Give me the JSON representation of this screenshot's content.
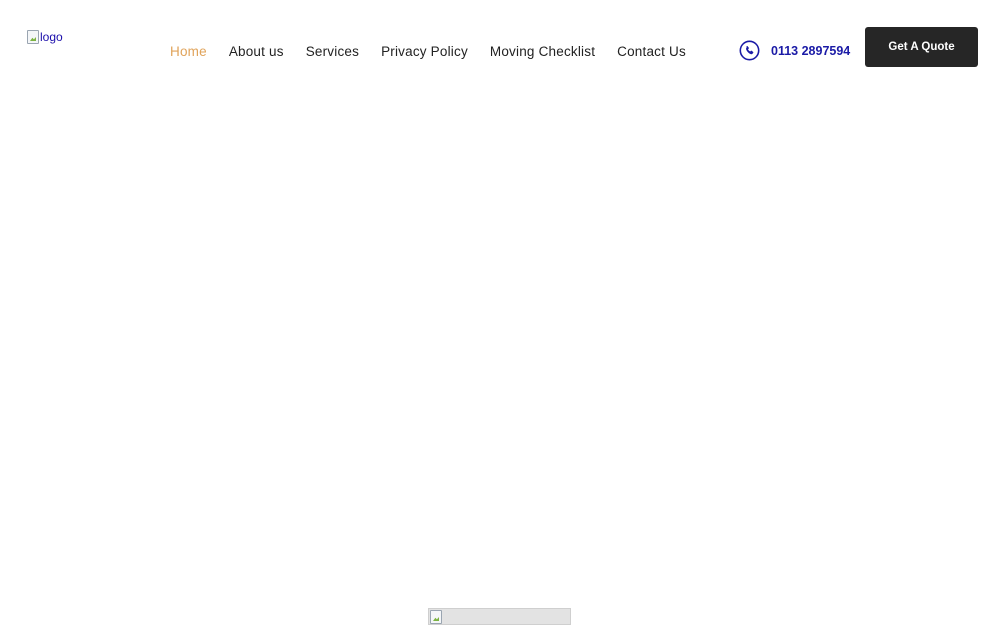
{
  "header": {
    "logo": {
      "alt_text": "logo",
      "icon": "broken-image-icon"
    },
    "nav": {
      "items": [
        {
          "label": "Home",
          "active": true
        },
        {
          "label": "About us",
          "active": false
        },
        {
          "label": "Services",
          "active": false
        },
        {
          "label": "Privacy Policy",
          "active": false
        },
        {
          "label": "Moving Checklist",
          "active": false
        },
        {
          "label": "Contact Us",
          "active": false
        }
      ]
    },
    "phone": {
      "icon": "phone-icon",
      "number": "0113 2897594"
    },
    "cta": {
      "label": "Get A Quote"
    }
  },
  "main": {
    "bottom_image": {
      "icon": "broken-image-icon"
    }
  },
  "colors": {
    "active_nav": "#e0a35a",
    "nav_text": "#222222",
    "phone_accent": "#1a1aa6",
    "button_bg": "#262626",
    "button_text": "#ffffff",
    "background": "#ffffff"
  }
}
